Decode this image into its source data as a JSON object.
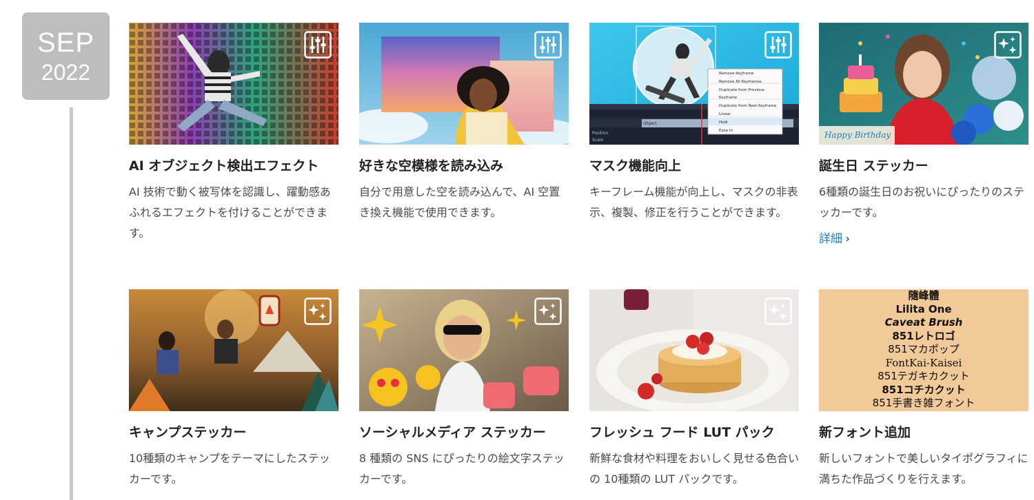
{
  "timeline": {
    "month": "SEP",
    "year": "2022"
  },
  "cards": [
    {
      "title": "AI オブジェクト検出エフェクト",
      "desc": "AI 技術で動く被写体を認識し、躍動感あふれるエフェクトを付けることができます。",
      "icon": "adjust-sliders-icon"
    },
    {
      "title": "好きな空模様を読み込み",
      "desc": "自分で用意した空を読み込んで、AI 空置き換え機能で使用できます。",
      "icon": "adjust-sliders-icon"
    },
    {
      "title": "マスク機能向上",
      "desc": "キーフレーム機能が向上し、マスクの非表示、複製、修正を行うことができます。",
      "icon": "adjust-sliders-icon",
      "menu": [
        "Remove Keyframe",
        "Remove All Keyframes",
        "Duplicate from Previous Keyframe",
        "Duplicate from Next Keyframe",
        "Linear",
        "Hold",
        "Ease In",
        "Ease Out"
      ],
      "timeline_labels": [
        "Position",
        "Scale",
        "Object"
      ]
    },
    {
      "title": "誕生日 ステッカー",
      "desc": "6種類の誕生日のお祝いにぴったりのステッカーです。",
      "link": "詳細",
      "icon": "sparkle-sticker-icon",
      "image_text": [
        "Happy Birthday"
      ]
    },
    {
      "title": "キャンプステッカー",
      "desc": "10種類のキャンプをテーマにしたステッカーです。",
      "icon": "sparkle-sticker-icon"
    },
    {
      "title": "ソーシャルメディア ステッカー",
      "desc": "8 種類の SNS にぴったりの絵文字ステッカーです。",
      "icon": "sparkle-sticker-icon"
    },
    {
      "title": "フレッシュ フード LUT パック",
      "desc": "新鮮な食材や料理をおいしく見せる色合いの 10種類の LUT パックです。",
      "icon": "sparkle-sticker-icon"
    },
    {
      "title": "新フォント追加",
      "desc": "新しいフォントで美しいタイポグラフィに満ちた作品づくりを行えます。",
      "icon": "sparkle-sticker-icon",
      "font_samples": [
        "隨峰體",
        "Lilita One",
        "Caveat Brush",
        "851レトロゴ",
        "851マカポップ",
        "FontKai-Kaisei",
        "851テガキカクット",
        "851コチカクット",
        "851手書き雑フォント"
      ]
    }
  ],
  "colors": {
    "link": "#1a7fc0",
    "badge_bg": "#bdbdbd",
    "timeline": "#c8c8c8"
  }
}
